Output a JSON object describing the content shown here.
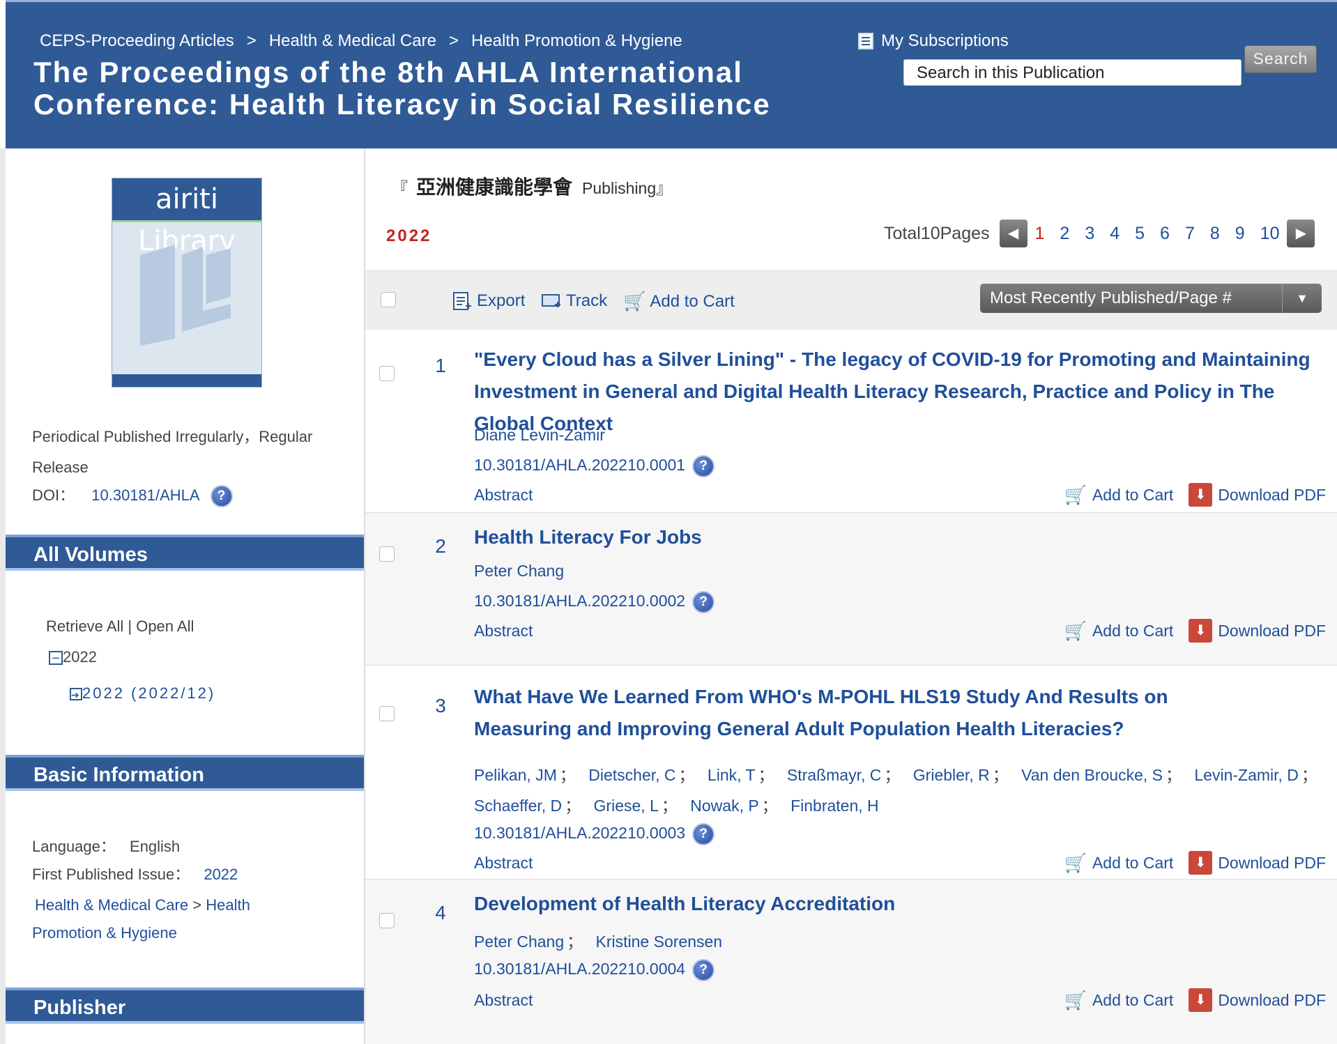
{
  "header": {
    "breadcrumbs": [
      "CEPS-Proceeding Articles",
      "Health & Medical Care",
      "Health Promotion & Hygiene"
    ],
    "breadcrumb_sep": ">",
    "title": "The Proceedings of the 8th AHLA International Conference: Health Literacy in Social Resilience",
    "subscriptions_label": "My Subscriptions",
    "search_placeholder": "Search in this Publication",
    "search_button": "Search"
  },
  "sidebar": {
    "cover_logo": "airiti Library",
    "periodical": "Periodical Published Irregularly，Regular Release",
    "doi_label": "DOI：",
    "doi_value": "10.30181/AHLA",
    "all_volumes": {
      "heading": "All Volumes",
      "retrieve_open": "Retrieve All | Open All",
      "year": "2022",
      "issue": "2022 (2022/12)"
    },
    "basic_info": {
      "heading": "Basic Information",
      "language_label": "Language：",
      "language_value": "English",
      "first_issue_label": "First Published Issue：",
      "first_issue_value": "2022",
      "subject_1": "Health & Medical Care",
      "subject_sep": ">",
      "subject_2a": "Health",
      "subject_2b": "Promotion & Hygiene"
    },
    "publisher_heading": "Publisher"
  },
  "main": {
    "publisher_open": "『",
    "publisher_zh": "亞洲健康識能學會",
    "publisher_label": "Publishing",
    "publisher_close": "』",
    "year": "2022",
    "total_pages": "Total10Pages",
    "pages": [
      "1",
      "2",
      "3",
      "4",
      "5",
      "6",
      "7",
      "8",
      "9",
      "10"
    ],
    "current_page": "1",
    "toolbar": {
      "export": "Export",
      "track": "Track",
      "add_to_cart": "Add to Cart",
      "sort": "Most Recently Published/Page #"
    },
    "actions": {
      "cart": "Add to Cart",
      "pdf": "Download PDF",
      "abstract": "Abstract"
    },
    "articles": [
      {
        "num": "1",
        "title": "\"Every Cloud has a Silver Lining\" - The legacy of COVID-19 for Promoting and Maintaining Investment in General and Digital Health Literacy Research, Practice and Policy in The Global Context",
        "authors": [
          "Diane Levin-Zamir"
        ],
        "doi": "10.30181/AHLA.202210.0001"
      },
      {
        "num": "2",
        "title": "Health Literacy For Jobs",
        "authors": [
          "Peter Chang"
        ],
        "doi": "10.30181/AHLA.202210.0002"
      },
      {
        "num": "3",
        "title": "What Have We Learned From WHO's M-POHL HLS19 Study And Results on Measuring and Improving General Adult Population Health Literacies?",
        "authors_line1": [
          "Pelikan, JM",
          "Dietscher, C",
          "Link, T",
          "Straßmayr, C",
          "Griebler, R",
          "Van den Broucke, S",
          "Levin-Zamir, D"
        ],
        "authors_line2": [
          "Schaeffer, D",
          "Griese, L",
          "Nowak, P",
          "Finbraten, H"
        ],
        "doi": "10.30181/AHLA.202210.0003"
      },
      {
        "num": "4",
        "title": "Development of Health Literacy Accreditation",
        "authors": [
          "Peter Chang",
          "Kristine Sorensen"
        ],
        "doi": "10.30181/AHLA.202210.0004"
      }
    ]
  },
  "colors": {
    "header_bg": "#2f5a95",
    "link": "#1f4f9a",
    "accent_red": "#c0251b"
  }
}
